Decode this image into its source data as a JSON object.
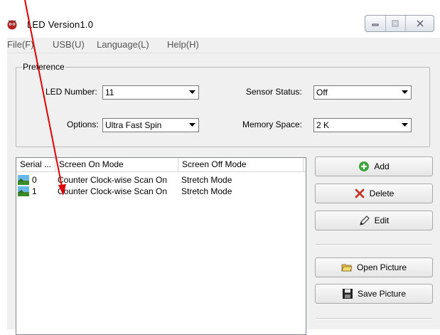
{
  "window": {
    "title": "LED  Version1.0",
    "controls": {
      "minimize": "—",
      "maximize": "▢",
      "close": "✕"
    }
  },
  "menu": {
    "items": [
      "File(F)",
      "USB(U)",
      "Language(L)",
      "Help(H)"
    ]
  },
  "preference": {
    "title": "Preference",
    "led_number_label": "LED Number:",
    "led_number_value": "11",
    "sensor_status_label": "Sensor Status:",
    "sensor_status_value": "Off",
    "options_label": "Options:",
    "options_value": "Ultra Fast Spin",
    "memory_space_label": "Memory Space:",
    "memory_space_value": "2 K"
  },
  "list": {
    "columns": [
      "Serial ...",
      "Screen On Mode",
      "Screen Off Mode"
    ],
    "rows": [
      {
        "serial": "0",
        "on_mode": "Counter Clock-wise Scan On",
        "off_mode": "Stretch Mode"
      },
      {
        "serial": "1",
        "on_mode": "Counter Clock-wise Scan On",
        "off_mode": "Stretch Mode"
      }
    ]
  },
  "buttons": {
    "add": "Add",
    "delete": "Delete",
    "edit": "Edit",
    "open_picture": "Open Picture",
    "save_picture": "Save Picture"
  },
  "colors": {
    "annotation_arrow": "#e00000",
    "add_icon": "#3aa33a",
    "delete_icon": "#c0392b"
  }
}
